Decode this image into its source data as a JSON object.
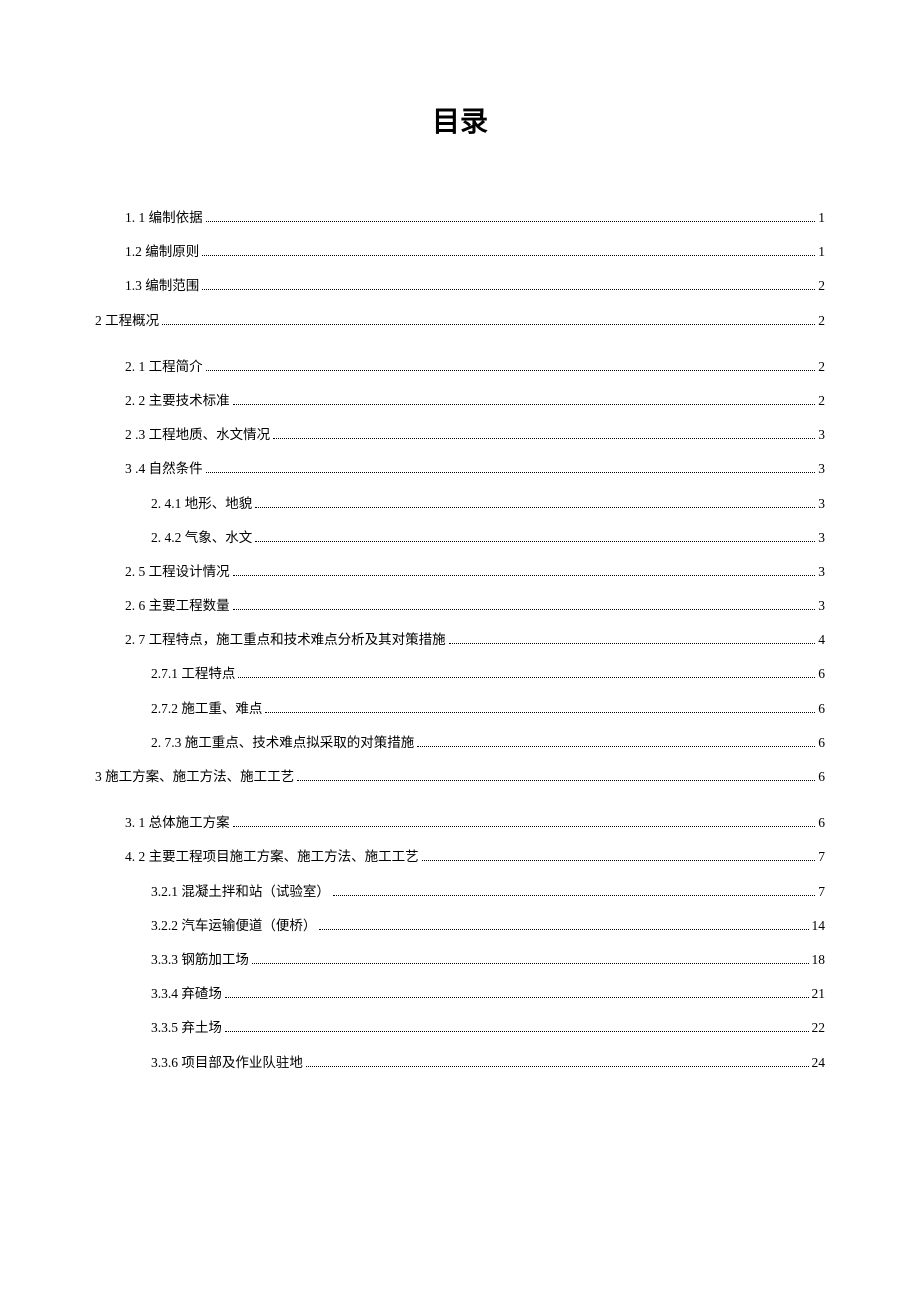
{
  "title": "目录",
  "toc": [
    {
      "level": 1,
      "label": "1. 1 编制依据",
      "page": "1"
    },
    {
      "level": 1,
      "label": "1.2 编制原则",
      "page": "1"
    },
    {
      "level": 1,
      "label": "1.3 编制范围",
      "page": "2"
    },
    {
      "level": 0,
      "label": "2 工程概况",
      "page": "2"
    },
    {
      "level": 1,
      "label": "2. 1 工程简介",
      "page": "2"
    },
    {
      "level": 1,
      "label": "2. 2 主要技术标准",
      "page": "2"
    },
    {
      "level": 1,
      "label": "2 .3 工程地质、水文情况",
      "page": "3"
    },
    {
      "level": 1,
      "label": "3 .4 自然条件",
      "page": "3"
    },
    {
      "level": 2,
      "label": "2. 4.1 地形、地貌",
      "page": "3"
    },
    {
      "level": 2,
      "label": "2. 4.2 气象、水文",
      "page": "3"
    },
    {
      "level": 1,
      "label": "2. 5 工程设计情况",
      "page": "3"
    },
    {
      "level": 1,
      "label": "2. 6 主要工程数量",
      "page": "3"
    },
    {
      "level": 1,
      "label": "2. 7 工程特点，施工重点和技术难点分析及其对策措施",
      "page": "4"
    },
    {
      "level": 2,
      "label": "2.7.1 工程特点",
      "page": "6"
    },
    {
      "level": 2,
      "label": "2.7.2 施工重、难点",
      "page": "6"
    },
    {
      "level": 2,
      "label": "2. 7.3 施工重点、技术难点拟采取的对策措施",
      "page": "6"
    },
    {
      "level": 0,
      "label": "3 施工方案、施工方法、施工工艺",
      "page": "6"
    },
    {
      "level": 1,
      "label": "3. 1 总体施工方案",
      "page": "6"
    },
    {
      "level": 1,
      "label": "4. 2 主要工程项目施工方案、施工方法、施工工艺",
      "page": "7"
    },
    {
      "level": 2,
      "label": "3.2.1 混凝土拌和站（试验室）",
      "page": "7"
    },
    {
      "level": 2,
      "label": "3.2.2 汽车运输便道（便桥）",
      "page": "14"
    },
    {
      "level": 2,
      "label": "3.3.3 钢筋加工场",
      "page": "18"
    },
    {
      "level": 2,
      "label": "3.3.4 弃碴场",
      "page": "21"
    },
    {
      "level": 2,
      "label": "3.3.5 弃土场",
      "page": "22"
    },
    {
      "level": 2,
      "label": "3.3.6 项目部及作业队驻地",
      "page": "24"
    }
  ]
}
